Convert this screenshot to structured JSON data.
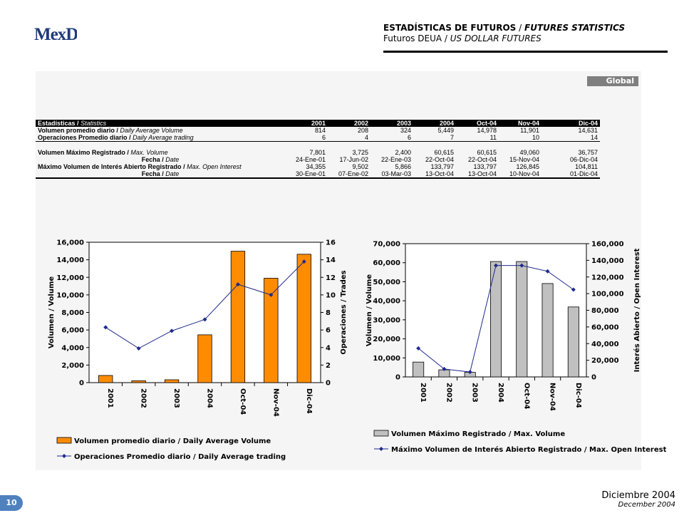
{
  "logo": {
    "text": "MexDer"
  },
  "header": {
    "title_es": "ESTADÍSTICAS DE FUTUROS",
    "title_en": "FUTURES STATISTICS",
    "subtitle_es": "Futuros DEUA",
    "subtitle_en": "US DOLLAR FUTURES",
    "separator": "/"
  },
  "badge": "Global",
  "table": {
    "header_es": "Estadísticas",
    "header_en": "Statistics",
    "columns": [
      "2001",
      "2002",
      "2003",
      "2004",
      "Oct-04",
      "Nov-04",
      "Dic-04"
    ],
    "rows": [
      {
        "label_es": "Volumen promedio diario",
        "label_en": "Daily Average Volume",
        "cells": [
          "814",
          "208",
          "324",
          "5,449",
          "14,978",
          "11,901",
          "14,631"
        ]
      },
      {
        "label_es": "Operaciones Promedio diario",
        "label_en": "Daily Average trading",
        "cells": [
          "6",
          "4",
          "6",
          "7",
          "11",
          "10",
          "14"
        ]
      },
      {
        "label_es": "Volumen Máximo Registrado",
        "label_en": "Max. Volume",
        "cells": [
          "7,801",
          "3,725",
          "2,400",
          "60,615",
          "60,615",
          "49,060",
          "36,757"
        ]
      },
      {
        "label_es": "Fecha",
        "label_en": "Date",
        "cells": [
          "24-Ene-01",
          "17-Jun-02",
          "22-Ene-03",
          "22-Oct-04",
          "22-Oct-04",
          "15-Nov-04",
          "06-Dic-04"
        ]
      },
      {
        "label_es": "Máximo Volumen de Interés Abierto Registrado",
        "label_en": "Max. Open Interest",
        "cells": [
          "34,355",
          "9,502",
          "5,866",
          "133,797",
          "133,797",
          "126,845",
          "104,811"
        ]
      },
      {
        "label_es": "Fecha",
        "label_en": "Date",
        "cells": [
          "30-Ene-01",
          "07-Ene-02",
          "03-Mar-03",
          "13-Oct-04",
          "13-Oct-04",
          "10-Nov-04",
          "01-Dic-04"
        ]
      }
    ]
  },
  "chart_data": [
    {
      "type": "bar",
      "categories": [
        "2001",
        "2002",
        "2003",
        "2004",
        "Oct-04",
        "Nov-04",
        "Dic-04"
      ],
      "series": [
        {
          "name": "Volumen promedio diario / Daily Average Volume",
          "type": "bar",
          "axis": "left",
          "values": [
            814,
            208,
            324,
            5449,
            14978,
            11901,
            14631
          ]
        },
        {
          "name": "Operaciones Promedio diario / Daily Average trading",
          "type": "line",
          "axis": "right",
          "values": [
            6.3,
            3.9,
            5.9,
            7.2,
            11.2,
            10.0,
            13.8
          ]
        }
      ],
      "ylabel": "Volumen / Volume",
      "y2label": "Operaciones / Trades",
      "ylim": [
        0,
        16000
      ],
      "y2lim": [
        0,
        16
      ],
      "yticks": [
        "0",
        "2,000",
        "4,000",
        "6,000",
        "8,000",
        "10,000",
        "12,000",
        "14,000",
        "16,000"
      ],
      "y2ticks": [
        "0",
        "2",
        "4",
        "6",
        "8",
        "10",
        "12",
        "14",
        "16"
      ],
      "grid": false,
      "legend_placement": "bottom",
      "colors": {
        "bar": "#ff8c00",
        "line": "#1f2a8c"
      }
    },
    {
      "type": "bar",
      "categories": [
        "2001",
        "2002",
        "2003",
        "2004",
        "Oct-04",
        "Nov-04",
        "Dic-04"
      ],
      "series": [
        {
          "name": "Volumen Máximo Registrado / Max. Volume",
          "type": "bar",
          "axis": "left",
          "values": [
            7801,
            3725,
            2400,
            60615,
            60615,
            49060,
            36757
          ]
        },
        {
          "name": "Máximo Volumen de Interés Abierto Registrado / Max. Open Interest",
          "type": "line",
          "axis": "right",
          "values": [
            34355,
            9502,
            5866,
            133797,
            133797,
            126845,
            104811
          ]
        }
      ],
      "ylabel": "Volumen / Volume",
      "y2label": "Interés Abierto / Open Interest",
      "ylim": [
        0,
        70000
      ],
      "y2lim": [
        0,
        160000
      ],
      "yticks": [
        "0",
        "10,000",
        "20,000",
        "30,000",
        "40,000",
        "50,000",
        "60,000",
        "70,000"
      ],
      "y2ticks": [
        "0",
        "20,000",
        "40,000",
        "60,000",
        "80,000",
        "100,000",
        "120,000",
        "140,000",
        "160,000"
      ],
      "grid": false,
      "legend_placement": "bottom",
      "colors": {
        "bar": "#c0c0c0",
        "line": "#1f2a8c"
      }
    }
  ],
  "footer": {
    "page": "10",
    "date_es": "Diciembre 2004",
    "date_en": "December 2004"
  }
}
